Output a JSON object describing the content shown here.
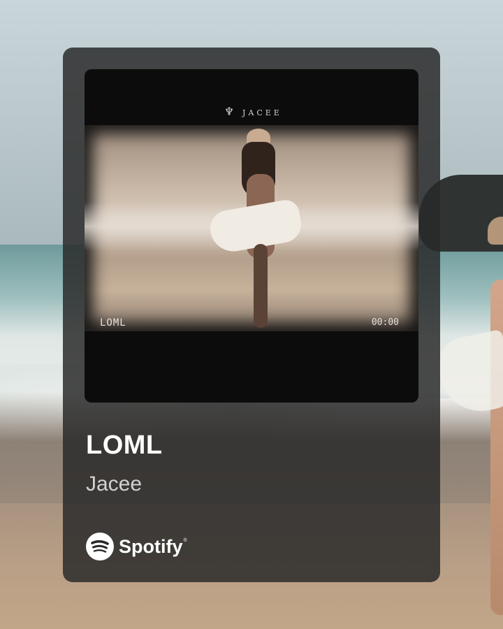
{
  "card": {
    "artwork": {
      "brand": "JACEE",
      "track_label": "LOML",
      "time_label": "00:00"
    },
    "track_title": "LOML",
    "artist": "Jacee",
    "service": {
      "name": "Spotify",
      "trademark": "®",
      "icon": "spotify-logo"
    }
  },
  "colors": {
    "card_background": "#282828",
    "title": "#ffffff",
    "artist": "#d2d2d2"
  }
}
